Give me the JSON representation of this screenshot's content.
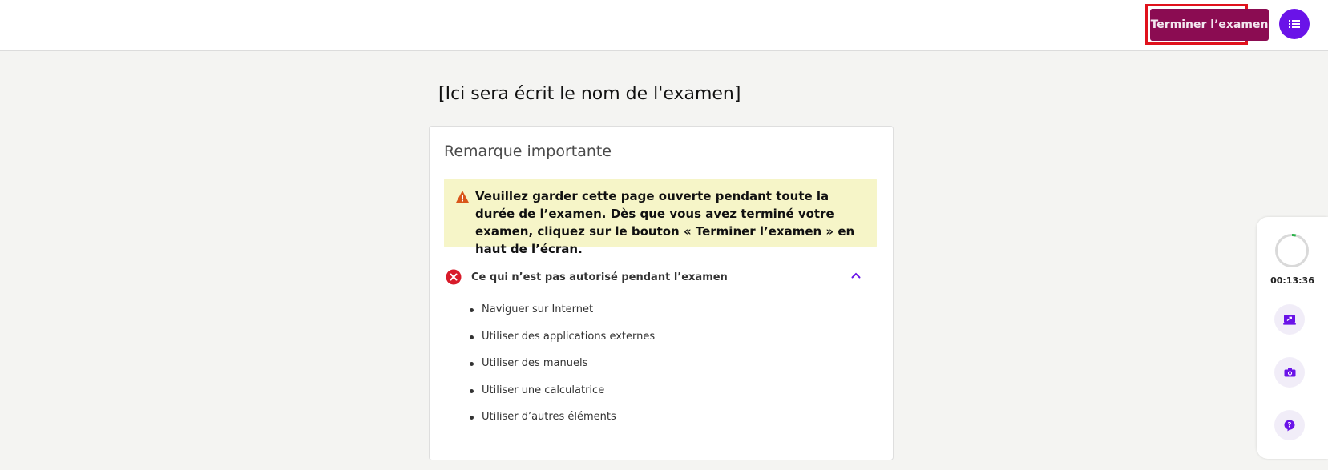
{
  "header": {
    "finish_button_label": "Terminer l’examen",
    "menu_icon": "list-icon"
  },
  "exam": {
    "title": "[Ici sera écrit le nom de l'examen]"
  },
  "notice": {
    "title": "Remarque importante",
    "warning_icon": "warning-triangle-icon",
    "warning_text": "Veuillez garder cette page ouverte pendant toute la durée de l’examen. Dès que vous avez terminé votre examen, cliquez sur le bouton « Terminer l’examen » en haut de l’écran.",
    "section": {
      "icon": "x-circle-icon",
      "label": "Ce qui n’est pas autorisé pendant l’examen",
      "expanded": true,
      "items": [
        "Naviguer sur Internet",
        "Utiliser des applications externes",
        "Utiliser des manuels",
        "Utiliser une calculatrice",
        "Utiliser d’autres éléments"
      ]
    }
  },
  "side_panel": {
    "timer": "00:13:36",
    "progress_fraction": 0.04,
    "buttons": [
      "screen-share-icon",
      "camera-icon",
      "help-icon"
    ]
  },
  "colors": {
    "finish_button": "#8b0c52",
    "highlight_outline": "#e0121c",
    "accent_purple": "#6a13e8",
    "warning_bg": "#f6f5c8",
    "timer_progress": "#2bb34a",
    "error_red": "#d81b2a"
  }
}
